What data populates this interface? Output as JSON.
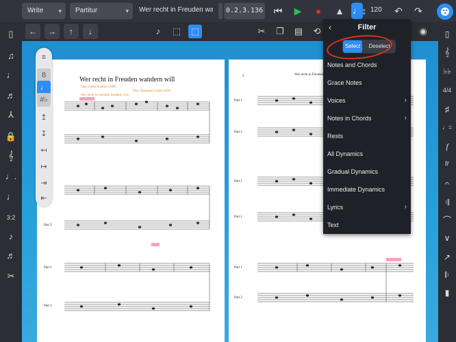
{
  "topbar": {
    "mode_dropdown": "Write",
    "layout_dropdown": "Partitur",
    "title": "Wer recht in Freuden wa...",
    "time_display": "0.2.3.136",
    "tempo_value": "120"
  },
  "score": {
    "page1_title": "Wer recht in Freuden wandern will",
    "page1_lines": [
      "Sata Gisela Hadlich 2008",
      "Text: Emanuel Geibel 1840",
      "Wer recht in Freuden wandern will"
    ],
    "page1_number": "",
    "page2_number": "2",
    "page2_header": "Wer recht in Freuden",
    "part1": "Part 1",
    "part2": "Part 2"
  },
  "filter": {
    "header": "Filter",
    "select_label": "Select",
    "deselect_label": "Deselect",
    "items": [
      {
        "label": "Notes and Chords",
        "has_submenu": false
      },
      {
        "label": "Grace Notes",
        "has_submenu": false
      },
      {
        "label": "Voices",
        "has_submenu": true
      },
      {
        "label": "Notes in Chords",
        "has_submenu": true
      },
      {
        "label": "Rests",
        "has_submenu": false
      },
      {
        "label": "All Dynamics",
        "has_submenu": false
      },
      {
        "label": "Gradual Dynamics",
        "has_submenu": false
      },
      {
        "label": "Immediate Dynamics",
        "has_submenu": false
      },
      {
        "label": "Lyrics",
        "has_submenu": true
      },
      {
        "label": "Text",
        "has_submenu": false
      }
    ]
  },
  "colors": {
    "accent": "#2f8df5",
    "annotation_red": "#e0321e",
    "score_bg": "#27a0db"
  }
}
